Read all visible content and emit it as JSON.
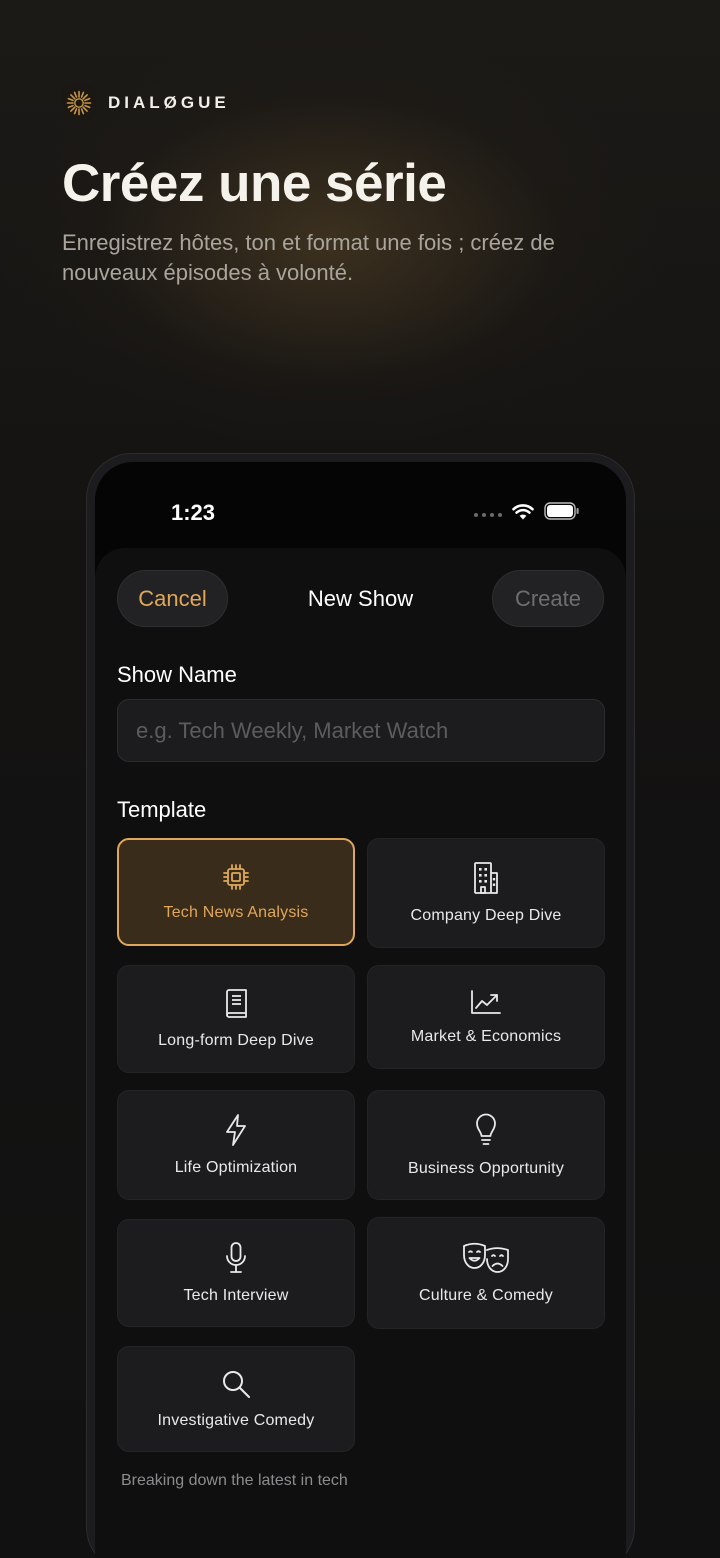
{
  "brand": {
    "name": "DIALØGUE",
    "logo_icon": "sunburst-icon",
    "accent": "#c89646"
  },
  "hero": {
    "title": "Créez une série",
    "subtitle": "Enregistrez hôtes, ton et format une fois ; créez de nouveaux épisodes à volonté."
  },
  "status_bar": {
    "time": "1:23"
  },
  "nav": {
    "cancel_label": "Cancel",
    "title": "New Show",
    "create_label": "Create"
  },
  "form": {
    "show_name_label": "Show Name",
    "show_name_placeholder": "e.g. Tech Weekly, Market Watch",
    "show_name_value": "",
    "template_label": "Template"
  },
  "templates": [
    {
      "label": "Tech News Analysis",
      "icon": "cpu-chip-icon",
      "selected": true
    },
    {
      "label": "Company Deep Dive",
      "icon": "building-icon",
      "selected": false
    },
    {
      "label": "Long-form Deep Dive",
      "icon": "book-icon",
      "selected": false
    },
    {
      "label": "Market & Economics",
      "icon": "trend-chart-icon",
      "selected": false
    },
    {
      "label": "Life Optimization",
      "icon": "lightning-icon",
      "selected": false
    },
    {
      "label": "Business Opportunity",
      "icon": "lightbulb-icon",
      "selected": false
    },
    {
      "label": "Tech Interview",
      "icon": "microphone-icon",
      "selected": false
    },
    {
      "label": "Culture & Comedy",
      "icon": "theater-masks-icon",
      "selected": false
    },
    {
      "label": "Investigative Comedy",
      "icon": "magnifying-glass-icon",
      "selected": false
    }
  ],
  "selected_template_description": "Breaking down the latest in tech",
  "colors": {
    "accent": "#e0a75a",
    "background": "#050505",
    "card": "#1c1c1e"
  }
}
